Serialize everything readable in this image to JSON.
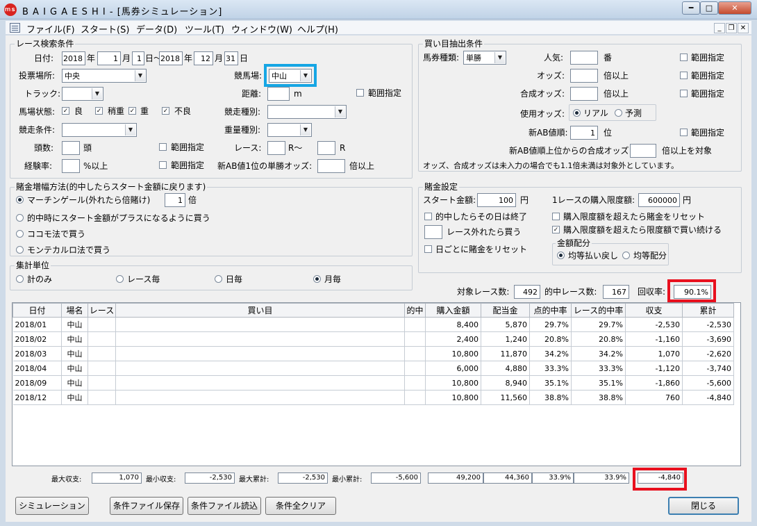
{
  "window": {
    "title": "B A I G A E S H I - [馬券シミュレーション]",
    "icon_text": "ｍｓ"
  },
  "menu": [
    "ファイル(F)",
    "スタート(S)",
    "データ(D)",
    "ツール(T)",
    "ウィンドウ(W)",
    "ヘルプ(H)"
  ],
  "race_search": {
    "title": "レース検索条件",
    "date_label": "日付:",
    "from_year": "2018",
    "from_month": "1",
    "from_day": "1",
    "to_year": "2018",
    "to_month": "12",
    "to_day": "31",
    "year_label": "年",
    "month_label": "月",
    "day_tilde": "日〜",
    "day_label": "日",
    "venue_label": "投票場所:",
    "venue_value": "中央",
    "course_label": "競馬場:",
    "course_value": "中山",
    "track_label": "トラック:",
    "track_value": "",
    "distance_label": "距離:",
    "distance_value": "",
    "distance_unit": "m",
    "range_label": "範囲指定",
    "condition_label": "馬場状態:",
    "cond_good": "良",
    "cond_slightly_heavy": "稍重",
    "cond_heavy": "重",
    "cond_bad": "不良",
    "race_type_label": "競走種別:",
    "race_type_value": "",
    "race_cond_label": "競走条件:",
    "race_cond_value": "",
    "weight_type_label": "重量種別:",
    "weight_type_value": "",
    "head_count_label": "頭数:",
    "head_count_value": "",
    "head_unit": "頭",
    "race_label": "レース:",
    "race_from": "",
    "race_tilde": "R〜",
    "race_to": "",
    "race_unit": "R",
    "experience_label": "経験率:",
    "experience_value": "",
    "experience_unit": "%以上",
    "ab_win_odds_label": "新AB値1位の単勝オッズ:",
    "ab_win_odds_value": "",
    "ab_win_odds_unit": "倍以上"
  },
  "bet_extract": {
    "title": "買い目抽出条件",
    "ticket_type_label": "馬券種類:",
    "ticket_type_value": "単勝",
    "popularity_label": "人気:",
    "popularity_value": "",
    "popularity_unit": "番",
    "odds_label": "オッズ:",
    "odds_value": "",
    "odds_unit": "倍以上",
    "combined_odds_label": "合成オッズ:",
    "combined_odds_value": "",
    "combined_odds_unit": "倍以上",
    "range_label": "範囲指定",
    "use_odds_label": "使用オッズ:",
    "use_odds_real": "リアル",
    "use_odds_forecast": "予測",
    "ab_rank_label": "新AB値順:",
    "ab_rank_value": "1",
    "ab_rank_unit": "位",
    "ab_combined_label": "新AB値順上位からの合成オッズ",
    "ab_combined_value": "",
    "ab_combined_unit": "倍以上を対象",
    "note": "オッズ、合成オッズは未入力の場合でも1.1倍未満は対象外としています。"
  },
  "stake_method": {
    "title": "賭金増幅方法(的中したらスタート金額に戻ります)",
    "martingale": "マーチンゲール(外れたら倍賭け)",
    "martingale_value": "1",
    "martingale_unit": "倍",
    "plus_when_hit": "的中時にスタート金額がプラスになるように買う",
    "cocomo": "ココモ法で買う",
    "montecarlo": "モンテカルロ法で買う"
  },
  "stake_settings": {
    "title": "賭金設定",
    "start_label": "スタート金額:",
    "start_value": "100",
    "start_unit": "円",
    "limit_label": "1レースの購入限度額:",
    "limit_value": "600000",
    "limit_unit": "円",
    "end_day_on_hit": "的中したらその日は終了",
    "buy_when_missed": "レース外れたら買う",
    "reset_daily": "日ごとに賭金をリセット",
    "reset_over_limit": "購入限度額を超えたら賭金をリセット",
    "continue_at_limit": "購入限度額を超えたら限度額で買い続ける",
    "alloc_title": "金額配分",
    "alloc_equal_payout": "均等払い戻し",
    "alloc_equal_bet": "均等配分"
  },
  "aggregate": {
    "title": "集計単位",
    "total_only": "計のみ",
    "per_race": "レース毎",
    "per_day": "日毎",
    "per_month": "月毎"
  },
  "stats": {
    "target_races_label": "対象レース数:",
    "target_races": "492",
    "hit_races_label": "的中レース数:",
    "hit_races": "167",
    "recovery_label": "回収率:",
    "recovery": "90.1%"
  },
  "table": {
    "headers": [
      "日付",
      "場名",
      "レース",
      "買い目",
      "的中",
      "購入金額",
      "配当金",
      "点的中率",
      "レース的中率",
      "収支",
      "累計"
    ],
    "rows": [
      [
        "2018/01",
        "中山",
        "",
        "",
        "",
        "8,400",
        "5,870",
        "29.7%",
        "29.7%",
        "-2,530",
        "-2,530"
      ],
      [
        "2018/02",
        "中山",
        "",
        "",
        "",
        "2,400",
        "1,240",
        "20.8%",
        "20.8%",
        "-1,160",
        "-3,690"
      ],
      [
        "2018/03",
        "中山",
        "",
        "",
        "",
        "10,800",
        "11,870",
        "34.2%",
        "34.2%",
        "1,070",
        "-2,620"
      ],
      [
        "2018/04",
        "中山",
        "",
        "",
        "",
        "6,000",
        "4,880",
        "33.3%",
        "33.3%",
        "-1,120",
        "-3,740"
      ],
      [
        "2018/09",
        "中山",
        "",
        "",
        "",
        "10,800",
        "8,940",
        "35.1%",
        "35.1%",
        "-1,860",
        "-5,600"
      ],
      [
        "2018/12",
        "中山",
        "",
        "",
        "",
        "10,800",
        "11,560",
        "38.8%",
        "38.8%",
        "760",
        "-4,840"
      ]
    ]
  },
  "summary": {
    "max_profit_label": "最大収支:",
    "max_profit": "1,070",
    "min_profit_label": "最小収支:",
    "min_profit": "-2,530",
    "max_cum_label": "最大累計:",
    "max_cum": "-2,530",
    "min_cum_label": "最小累計:",
    "min_cum": "-5,600",
    "total_purchase": "49,200",
    "total_payout": "44,360",
    "point_hit_rate": "33.9%",
    "race_hit_rate": "33.9%",
    "total_balance": "-4,840"
  },
  "buttons": {
    "simulate": "シミュレーション",
    "save_conditions": "条件ファイル保存",
    "load_conditions": "条件ファイル読込",
    "clear_conditions": "条件全クリア",
    "close": "閉じる"
  }
}
